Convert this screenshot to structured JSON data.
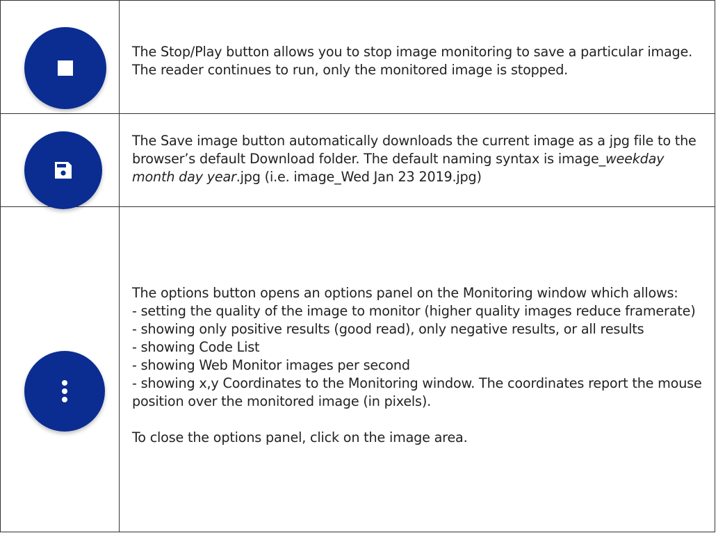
{
  "accent_color": "#0B2D91",
  "rows": [
    {
      "icon": "stop-icon",
      "text": "The Stop/Play button allows you to stop image monitoring to save a particular image. The reader continues to run, only the monitored image is stopped."
    },
    {
      "icon": "save-icon",
      "text_line1": "The Save image button automatically downloads the current image as a jpg file to the browser’s default Download folder. The default naming syntax is",
      "syntax_prefix": "image_",
      "syntax_italic": "weekday month day year",
      "syntax_suffix": ".jpg (i.e. image_Wed Jan 23 2019.jpg)"
    },
    {
      "icon": "more-vert-icon",
      "intro": "The options button opens an options panel on the Monitoring window which allows:",
      "items": [
        "- setting the quality of the image to monitor (higher quality images reduce framerate)",
        "- showing only positive results (good read), only negative results, or all results",
        "- showing Code List",
        "- showing Web Monitor images per second",
        "- showing x,y Coordinates to the Monitoring window. The coordinates report the mouse position over the monitored image (in pixels)."
      ],
      "closing": "To close the options panel, click on the image area."
    }
  ]
}
